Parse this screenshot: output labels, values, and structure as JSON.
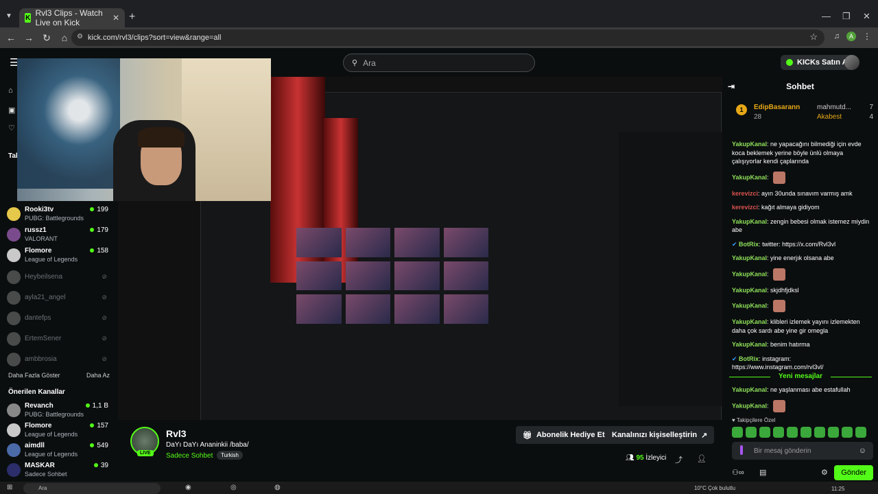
{
  "browser": {
    "tab_title": "Rvl3 Clips - Watch Live on Kick",
    "tab_favicon": "K",
    "url": "kick.com/rvl3/clips?sort=view&range=all",
    "profile_initial": "A"
  },
  "header": {
    "search_placeholder": "Ara",
    "kicks_label": "KICKs Satın Al"
  },
  "sidebar": {
    "channels": [
      {
        "name": "Rooki3tv",
        "game": "PUBG: Battlegrounds",
        "viewers": "199",
        "color": "#e6c84a"
      },
      {
        "name": "russz1",
        "game": "VALORANT",
        "viewers": "179",
        "color": "#7a4b8c"
      },
      {
        "name": "Flomore",
        "game": "League of Legends",
        "viewers": "158",
        "color": "#c9c9c9"
      }
    ],
    "offline": [
      "Heybeilsena",
      "ayla21_angel",
      "dantefps",
      "ErtemSener",
      "ambbrosia"
    ],
    "more_label": "Daha Fazla Göster",
    "less_label": "Daha Az",
    "recommended_title": "Önerilen Kanallar",
    "recommended": [
      {
        "name": "Revanch",
        "game": "PUBG: Battlegrounds",
        "viewers": "1,1 B",
        "color": "#888"
      },
      {
        "name": "Flomore",
        "game": "League of Legends",
        "viewers": "157",
        "color": "#c9c9c9"
      },
      {
        "name": "aimdll",
        "game": "League of Legends",
        "viewers": "549",
        "color": "#4a6aa8"
      },
      {
        "name": "MASKAR",
        "game": "Sadece Sohbet",
        "viewers": "39",
        "color": "#2b2e6a"
      }
    ],
    "partial_label": "Tak"
  },
  "channel": {
    "name": "Rvl3",
    "title": "DaYı  DaYı Ananinkii /baba/",
    "category": "Sadece Sohbet",
    "tag": "Turkish",
    "live_label": "LIVE",
    "gift_button": "Abonelik Hediye Et",
    "customize_button": "Kanalınızı kişiselleştirin",
    "viewers_count": "95",
    "viewers_label": "İzleyici"
  },
  "chat": {
    "title": "Sohbet",
    "pinned": {
      "rank": "1",
      "user1": "EdipBasarann",
      "count1": "28",
      "user2": "mahmutd...",
      "count2": "7",
      "user3": "Akabest",
      "count3": "4"
    },
    "messages": [
      {
        "user": "YakupKanal",
        "text": "ne yapacağını bilmediği için evde koca beklemek yerine böyle ünlü olmaya çalışıyorlar kendi çaplarında",
        "color": "g"
      },
      {
        "user": "YakupKanal",
        "text": "",
        "color": "g",
        "emoji": true
      },
      {
        "user": "kerevizci",
        "text": "ayın 30unda sınavım varmış amk",
        "color": "r"
      },
      {
        "user": "kerevizci",
        "text": "kağıt almaya gidiyom",
        "color": "r"
      },
      {
        "user": "YakupKanal",
        "text": "zengin bebesi olmak istemez miydin abe",
        "color": "g"
      },
      {
        "user": "BotRix",
        "text": "twitter: https://x.com/Rvl3vl",
        "color": "g",
        "bot": true
      },
      {
        "user": "YakupKanal",
        "text": "yine enerjık olsana abe",
        "color": "g"
      },
      {
        "user": "YakupKanal",
        "text": "",
        "color": "g",
        "emoji": true
      },
      {
        "user": "YakupKanal",
        "text": "skjdhfjdksl",
        "color": "g"
      },
      {
        "user": "YakupKanal",
        "text": "",
        "color": "g",
        "emoji": true
      },
      {
        "user": "YakupKanal",
        "text": "klibleri izlemek yayını izlemekten daha çok sardı abe yine gir omegla",
        "color": "g"
      },
      {
        "user": "YakupKanal",
        "text": "benim hatırma",
        "color": "g"
      },
      {
        "user": "BotRix",
        "text": "instagram: https://www.instagram.com/rvl3vl/",
        "color": "g",
        "bot": true
      }
    ],
    "new_messages_label": "Yeni mesajlar",
    "after_new": [
      {
        "user": "YakupKanal",
        "text": "ne yaşlanması abe estafullah",
        "color": "g"
      },
      {
        "user": "YakupKanal",
        "text": "",
        "color": "g",
        "emoji": true
      }
    ],
    "subs_label": "Takipçilere Özel",
    "input_placeholder": "Bir mesaj gönderin",
    "send_label": "Gönder"
  },
  "taskbar": {
    "search": "Ara",
    "clock": "11:25",
    "weather": "10°C  Çok bulutlu"
  }
}
